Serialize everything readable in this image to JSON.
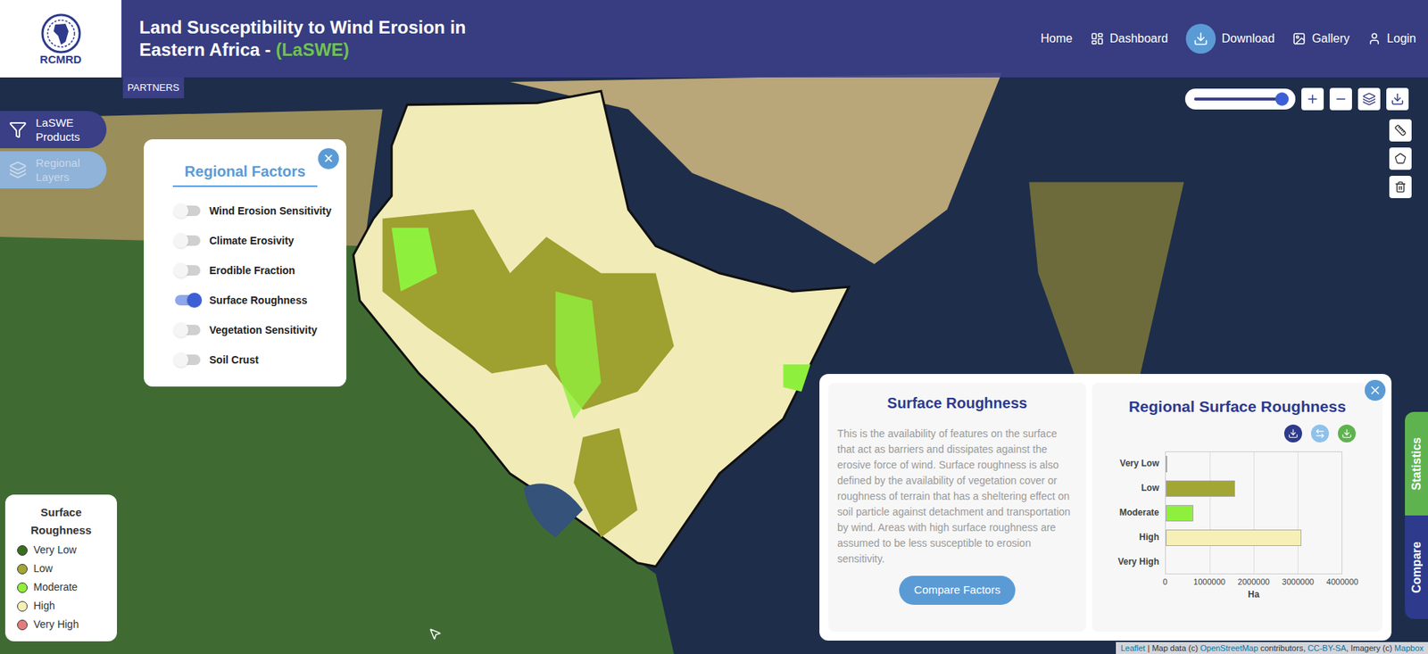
{
  "header": {
    "logo_text": "RCMRD",
    "title": "Land Susceptibility to Wind Erosion in Eastern Africa - ",
    "title_accent": "(LaSWE)",
    "nav": [
      {
        "label": "Home",
        "icon": "home"
      },
      {
        "label": "Dashboard",
        "icon": "dashboard"
      },
      {
        "label": "Download",
        "icon": "download"
      },
      {
        "label": "Gallery",
        "icon": "gallery"
      },
      {
        "label": "Login",
        "icon": "login"
      }
    ]
  },
  "partners_tab": "PARTNERS",
  "side_buttons": [
    {
      "label": "LaSWE Products",
      "disabled": false
    },
    {
      "label": "Regional Layers",
      "disabled": true
    }
  ],
  "factors_panel": {
    "title": "Regional Factors",
    "close": "×",
    "items": [
      {
        "label": "Wind Erosion Sensitivity",
        "on": false
      },
      {
        "label": "Climate Erosivity",
        "on": false
      },
      {
        "label": "Erodible Fraction",
        "on": false
      },
      {
        "label": "Surface Roughness",
        "on": true
      },
      {
        "label": "Vegetation Sensitivity",
        "on": false
      },
      {
        "label": "Soil Crust",
        "on": false
      }
    ]
  },
  "opacity_slider": {
    "level": 0.95
  },
  "legend": {
    "title": "Surface Roughness",
    "items": [
      {
        "label": "Very Low",
        "color": "#3b6e1c"
      },
      {
        "label": "Low",
        "color": "#a2a634"
      },
      {
        "label": "Moderate",
        "color": "#8ef03c"
      },
      {
        "label": "High",
        "color": "#f6f0b6"
      },
      {
        "label": "Very High",
        "color": "#e27d7d"
      }
    ]
  },
  "info": {
    "title": "Surface Roughness",
    "description": "This is the availability of features on the surface that act as barriers and dissipates against the erosive force of wind. Surface roughness is also defined by the availability of vegetation cover or roughness of terrain that has a sheltering effect on soil particle against detachment and transportation by wind. Areas with high surface roughness are assumed to be less susceptible to erosion sensitivity.",
    "button": "Compare Factors"
  },
  "chart": {
    "title": "Regional Surface Roughness",
    "categories": [
      "Very Low",
      "Low",
      "Moderate",
      "High",
      "Very High"
    ],
    "values": [
      20000,
      1570000,
      630000,
      3080000,
      0
    ],
    "max": 4000000,
    "ticks": [
      "0",
      "1000000",
      "2000000",
      "3000000",
      "4000000"
    ],
    "x_label": "Ha"
  },
  "right_tabs": [
    {
      "label": "Statistics",
      "color": "#5fb34f"
    },
    {
      "label": "Compare",
      "color": "#2e3a8c"
    }
  ],
  "attribution": {
    "parts": [
      {
        "text": "Leaflet",
        "link": true
      },
      {
        "text": " | Map data (c) ",
        "link": false
      },
      {
        "text": "OpenStreetMap",
        "link": true
      },
      {
        "text": " contributors, ",
        "link": false
      },
      {
        "text": "CC-BY-SA",
        "link": true
      },
      {
        "text": ", Imagery (c) ",
        "link": false
      },
      {
        "text": "Mapbox",
        "link": true
      }
    ]
  }
}
